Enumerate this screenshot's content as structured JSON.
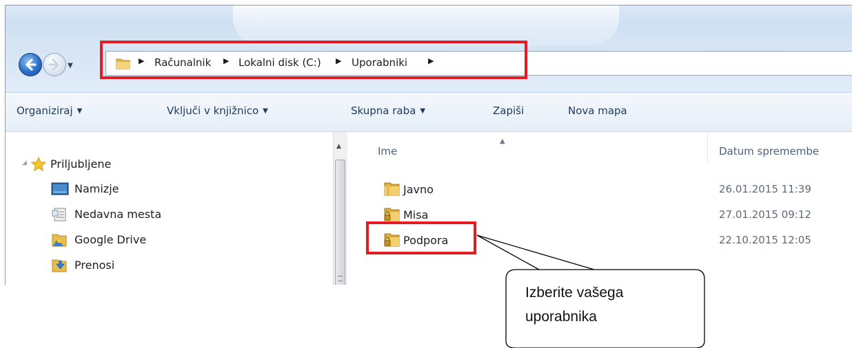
{
  "address_bar": {
    "breadcrumbs": [
      "Računalnik",
      "Lokalni disk (C:)",
      "Uporabniki"
    ]
  },
  "toolbar": {
    "organize": "Organiziraj",
    "include_in_library": "Vključi v knjižnico",
    "share_with": "Skupna raba",
    "burn": "Zapiši",
    "new_folder": "Nova mapa"
  },
  "nav_pane": {
    "favorites_label": "Priljubljene",
    "items": [
      {
        "label": "Namizje",
        "icon": "desktop-icon"
      },
      {
        "label": "Nedavna mesta",
        "icon": "recent-places-icon"
      },
      {
        "label": "Google Drive",
        "icon": "google-drive-folder-icon"
      },
      {
        "label": "Prenosi",
        "icon": "downloads-folder-icon"
      }
    ]
  },
  "file_list": {
    "columns": {
      "name": "Ime",
      "date": "Datum spremembe"
    },
    "rows": [
      {
        "name": "Javno",
        "date": "26.01.2015 11:39",
        "icon": "folder-icon"
      },
      {
        "name": "Misa",
        "date": "27.01.2015 09:12",
        "icon": "locked-folder-icon"
      },
      {
        "name": "Podpora",
        "date": "22.10.2015 12:05",
        "icon": "locked-folder-icon"
      }
    ]
  },
  "callout": {
    "line1": "Izberite vašega",
    "line2": "uporabnika"
  },
  "colors": {
    "highlight_red": "#e51b24",
    "toolbar_text": "#1e395b",
    "date_text": "#5f6b7a"
  }
}
